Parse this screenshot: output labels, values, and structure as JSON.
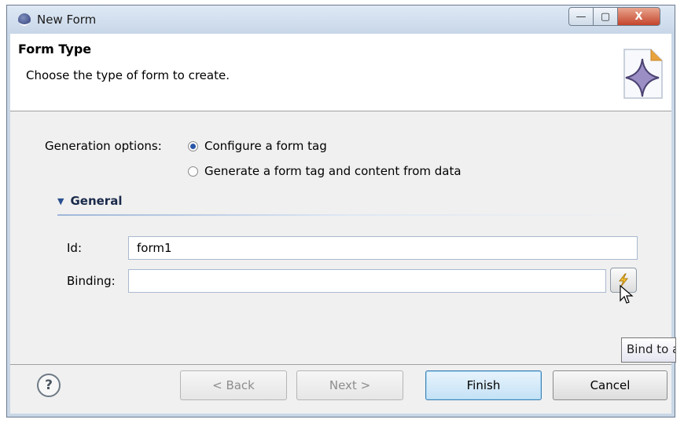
{
  "window": {
    "title": "New Form",
    "min_glyph": "—",
    "max_glyph": "▢",
    "close_glyph": "X",
    "icon": "globe-icon"
  },
  "header": {
    "title": "Form Type",
    "description": "Choose the type of form to create.",
    "icon": "wizard-form-icon"
  },
  "generation": {
    "label": "Generation options:",
    "options": [
      {
        "label": "Configure a form tag",
        "selected": true
      },
      {
        "label": "Generate a form tag and content from data",
        "selected": false
      }
    ]
  },
  "section": {
    "title": "General",
    "expanded": true
  },
  "fields": {
    "id": {
      "label": "Id:",
      "value": "form1"
    },
    "binding": {
      "label": "Binding:",
      "value": ""
    }
  },
  "bind_button": {
    "icon": "lightning-bind-icon"
  },
  "tooltip": {
    "text": "Bind to a"
  },
  "footer": {
    "help_glyph": "?",
    "back": "< Back",
    "next": "Next >",
    "finish": "Finish",
    "cancel": "Cancel"
  },
  "colors": {
    "accent": "#2a56a8",
    "default_button": "#c4e1f6",
    "close_button": "#c4452c"
  }
}
